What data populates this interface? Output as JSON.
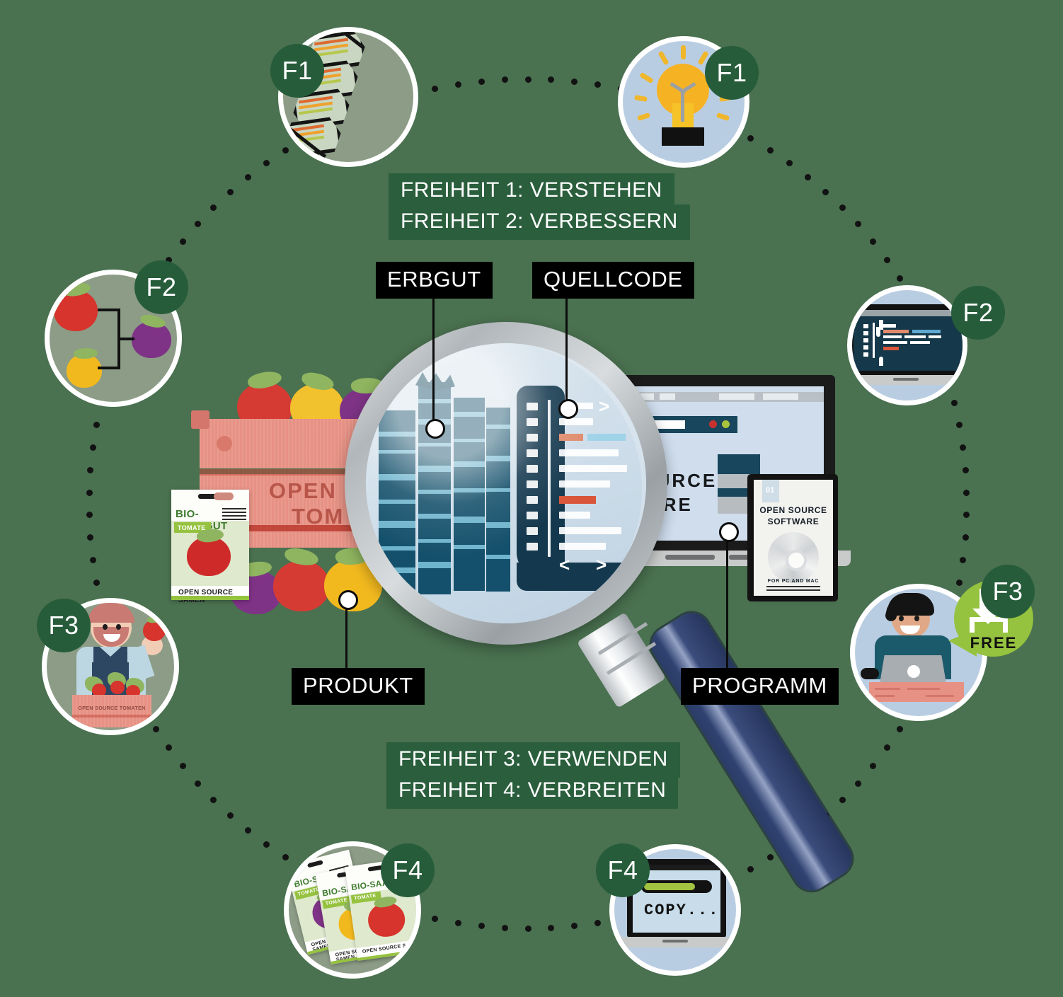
{
  "background_color": "#4a7150",
  "theme": {
    "badge_color": "#265c3a",
    "banner_color": "#2a5e3c",
    "tag_color": "#000000",
    "accent_green": "#95c23f",
    "handle_blue": "#2b3c66"
  },
  "banners": {
    "top": [
      {
        "text": "FREIHEIT 1: VERSTEHEN"
      },
      {
        "text": "FREIHEIT 2: VERBESSERN"
      }
    ],
    "bottom": [
      {
        "text": "FREIHEIT 3: VERWENDEN"
      },
      {
        "text": "FREIHEIT 4: VERBREITEN"
      }
    ]
  },
  "callouts": {
    "erbgut": "ERBGUT",
    "quellcode": "QUELLCODE",
    "produkt": "PRODUKT",
    "programm": "PROGRAMM"
  },
  "nodes": [
    {
      "id": "dna",
      "badge": "F1",
      "icon": "dna-helix-icon",
      "side": "nature"
    },
    {
      "id": "lightbulb",
      "badge": "F1",
      "icon": "lightbulb-icon",
      "side": "software"
    },
    {
      "id": "tomatoes",
      "badge": "F2",
      "icon": "tomato-variants-icon",
      "side": "nature"
    },
    {
      "id": "codelaptop",
      "badge": "F2",
      "icon": "code-laptop-icon",
      "side": "software"
    },
    {
      "id": "farmer",
      "badge": "F3",
      "icon": "farmer-icon",
      "side": "nature"
    },
    {
      "id": "developer",
      "badge": "F3",
      "icon": "developer-icon",
      "side": "software"
    },
    {
      "id": "seedpacks",
      "badge": "F4",
      "icon": "seed-packets-icon",
      "side": "nature"
    },
    {
      "id": "copylaptop",
      "badge": "F4",
      "icon": "copy-laptop-icon",
      "side": "software"
    }
  ],
  "node_text": {
    "farmer_crate": "OPEN SOURCE TOMATEN",
    "free_bubble": "FREE",
    "copy_screen": "COPY...",
    "packet_brand": "BIO-SAATGUT",
    "packet_variety": "TOMATE",
    "packet_footer": "OPEN SOURCE SAMEN"
  },
  "center": {
    "crate_line1": "OPEN S",
    "crate_line2": "TOM",
    "packet_brand": "BIO-SAATGUT",
    "packet_variety": "TOMATE",
    "packet_footer": "OPEN SOURCE SAMEN",
    "laptop_line1": "SOURCE",
    "laptop_line2": "TWARE",
    "swbox_number": "01",
    "swbox_title1": "OPEN SOURCE",
    "swbox_title2": "SOFTWARE",
    "swbox_footer": "FOR PC AND MAC"
  }
}
